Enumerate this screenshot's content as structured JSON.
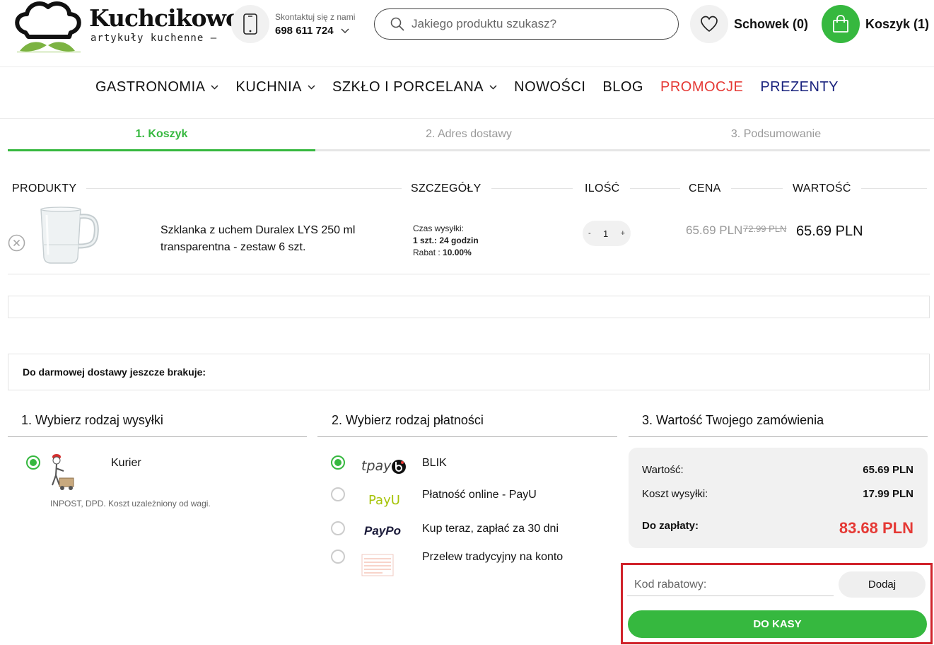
{
  "header": {
    "logo_title": "Kuchcikowo",
    "logo_subtitle": "artykuły kuchenne —",
    "contact_label": "Skontaktuj się z nami",
    "contact_phone": "698 611 724",
    "search_placeholder": "Jakiego produktu szukasz?",
    "wishlist_label": "Schowek (0)",
    "cart_label": "Koszyk (1)"
  },
  "nav": {
    "items": [
      {
        "label": "GASTRONOMIA",
        "dropdown": true
      },
      {
        "label": "KUCHNIA",
        "dropdown": true
      },
      {
        "label": "SZKŁO I PORCELANA",
        "dropdown": true
      },
      {
        "label": "NOWOŚCI"
      },
      {
        "label": "BLOG"
      },
      {
        "label": "PROMOCJE",
        "color": "#e53935"
      },
      {
        "label": "PREZENTY",
        "color": "#1a237e"
      }
    ]
  },
  "steps": {
    "step1": "1. Koszyk",
    "step2": "2. Adres dostawy",
    "step3": "3. Podsumowanie",
    "active": 1
  },
  "table": {
    "headers": {
      "products": "PRODUKTY",
      "details": "SZCZEGÓŁY",
      "quantity": "ILOŚĆ",
      "price": "CENA",
      "value": "WARTOŚĆ"
    },
    "rows": [
      {
        "name": "Szklanka z uchem Duralex LYS 250 ml transparentna - zestaw 6 szt.",
        "shipping_time_label": "Czas wysyłki:",
        "shipping_qty": "1 szt.:",
        "shipping_time": "24 godzin",
        "discount_label": "Rabat :",
        "discount": "10.00%",
        "qty_minus": "-",
        "qty": "1",
        "qty_plus": "+",
        "price": "65.69 PLN",
        "price_old": "72.99 PLN",
        "value": "65.69 PLN"
      }
    ]
  },
  "free_shipping_text": "Do darmowej dostawy jeszcze brakuje:",
  "shipping": {
    "title": "1. Wybierz rodzaj wysyłki",
    "options": [
      {
        "label": "Kurier",
        "note": "INPOST, DPD. Koszt uzależniony od wagi.",
        "selected": true
      }
    ]
  },
  "payment": {
    "title": "2. Wybierz rodzaj płatności",
    "options": [
      {
        "logo": "tpay",
        "label": "BLIK",
        "selected": true
      },
      {
        "logo": "PayU",
        "label": "Płatność online - PayU",
        "selected": false
      },
      {
        "logo": "PayPo",
        "label": "Kup teraz, zapłać za 30 dni",
        "selected": false
      },
      {
        "logo": "przelew",
        "label": "Przelew tradycyjny na konto",
        "selected": false
      }
    ]
  },
  "summary": {
    "title": "3. Wartość Twojego zamówienia",
    "value_label": "Wartość:",
    "value": "65.69 PLN",
    "shipping_label": "Koszt wysyłki:",
    "shipping": "17.99 PLN",
    "total_label": "Do zapłaty:",
    "total": "83.68 PLN"
  },
  "coupon": {
    "placeholder": "Kod rabatowy:",
    "add_label": "Dodaj",
    "checkout_label": "DO KASY"
  },
  "colors": {
    "accent": "#36b83f",
    "promo": "#e53935",
    "gift": "#1a237e",
    "highlight": "#d0232b"
  }
}
